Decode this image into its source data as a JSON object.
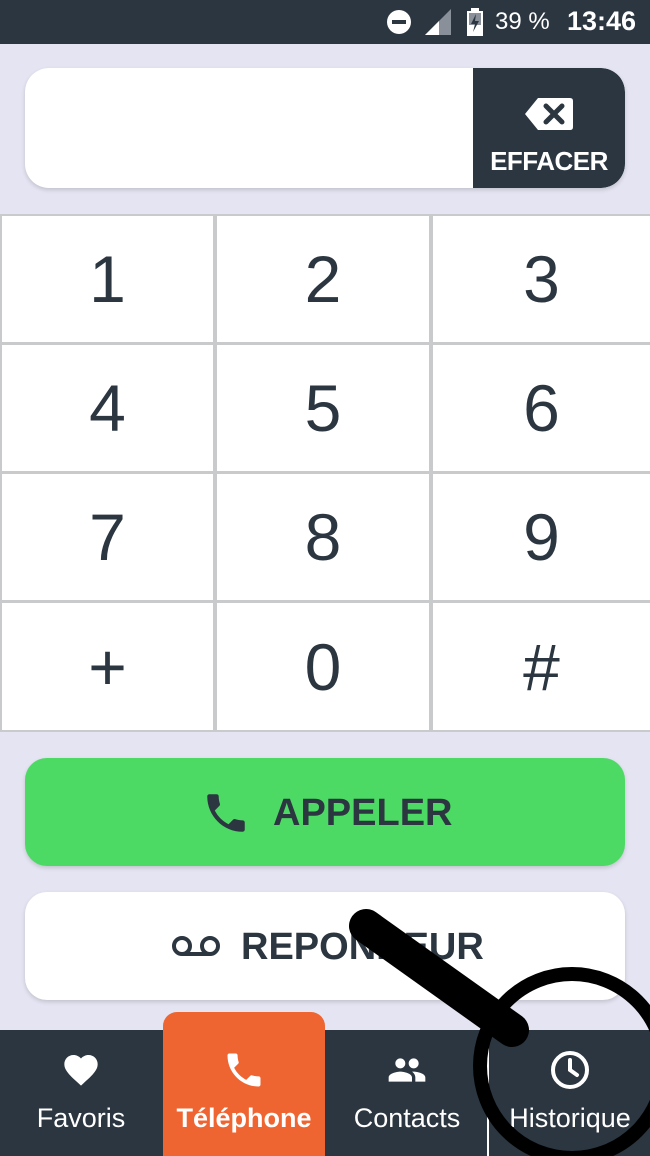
{
  "status_bar": {
    "battery_percent": "39 %",
    "time": "13:46",
    "icons": [
      "do-not-disturb-icon",
      "signal-icon",
      "battery-charging-icon"
    ]
  },
  "number_field": {
    "value": "",
    "erase_label": "EFFACER",
    "erase_icon": "backspace-icon"
  },
  "keypad": {
    "keys": [
      "1",
      "2",
      "3",
      "4",
      "5",
      "6",
      "7",
      "8",
      "9",
      "+",
      "0",
      "#"
    ]
  },
  "call_button": {
    "label": "APPELER",
    "icon": "phone-icon",
    "color": "#4cd964"
  },
  "voicemail_button": {
    "label": "REPONDEUR",
    "icon": "voicemail-icon"
  },
  "bottom_nav": {
    "items": [
      {
        "label": "Favoris",
        "icon": "heart-icon",
        "active": false
      },
      {
        "label": "Téléphone",
        "icon": "phone-icon",
        "active": true
      },
      {
        "label": "Contacts",
        "icon": "contacts-icon",
        "active": false
      },
      {
        "label": "Historique",
        "icon": "clock-icon",
        "active": false
      }
    ],
    "active_color": "#ef6532"
  },
  "overlay": {
    "icon": "magnifier-icon"
  },
  "colors": {
    "dark": "#2b3640",
    "background": "#e4e4f2"
  }
}
